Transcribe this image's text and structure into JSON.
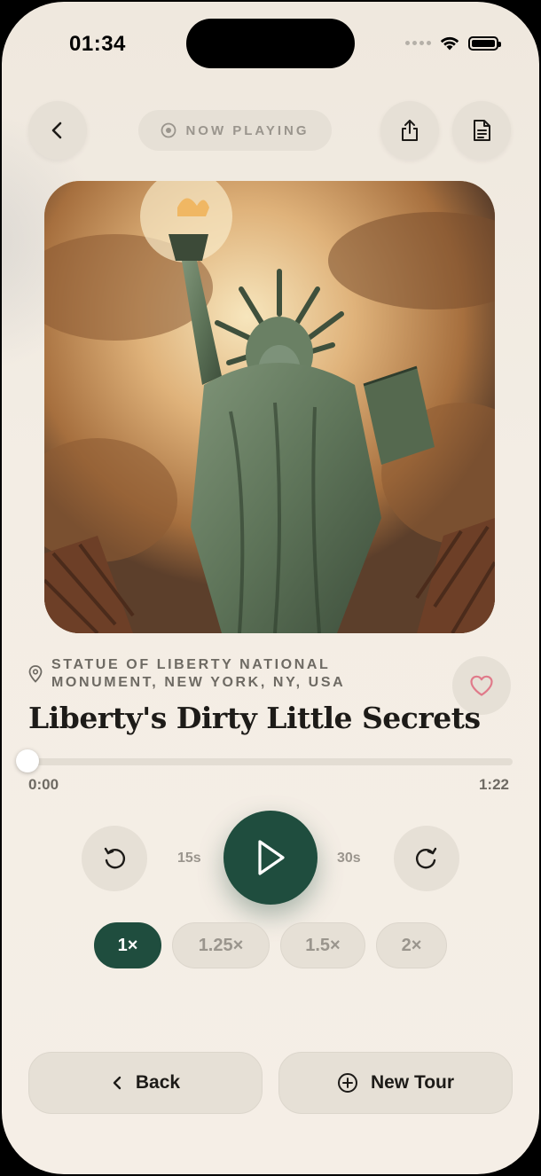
{
  "status": {
    "time": "01:34"
  },
  "header": {
    "now_playing_label": "NOW PLAYING"
  },
  "tour": {
    "location": "STATUE OF LIBERTY NATIONAL MONUMENT, NEW YORK, NY, USA",
    "title": "Liberty's Dirty Little Secrets"
  },
  "player": {
    "elapsed": "0:00",
    "total": "1:22",
    "progress": 0,
    "rewind_label": "15s",
    "forward_label": "30s"
  },
  "speeds": [
    {
      "label": "1×",
      "active": true
    },
    {
      "label": "1.25×",
      "active": false
    },
    {
      "label": "1.5×",
      "active": false
    },
    {
      "label": "2×",
      "active": false
    }
  ],
  "footer": {
    "back_label": "Back",
    "new_tour_label": "New Tour"
  },
  "colors": {
    "accent": "#1f4d3e",
    "heart": "#e07a8a",
    "background": "#f3ede4"
  },
  "icons": [
    "chevron-left-icon",
    "share-icon",
    "document-icon",
    "location-pin-icon",
    "heart-icon",
    "rewind-icon",
    "play-icon",
    "forward-icon",
    "plus-circle-icon",
    "target-icon"
  ]
}
